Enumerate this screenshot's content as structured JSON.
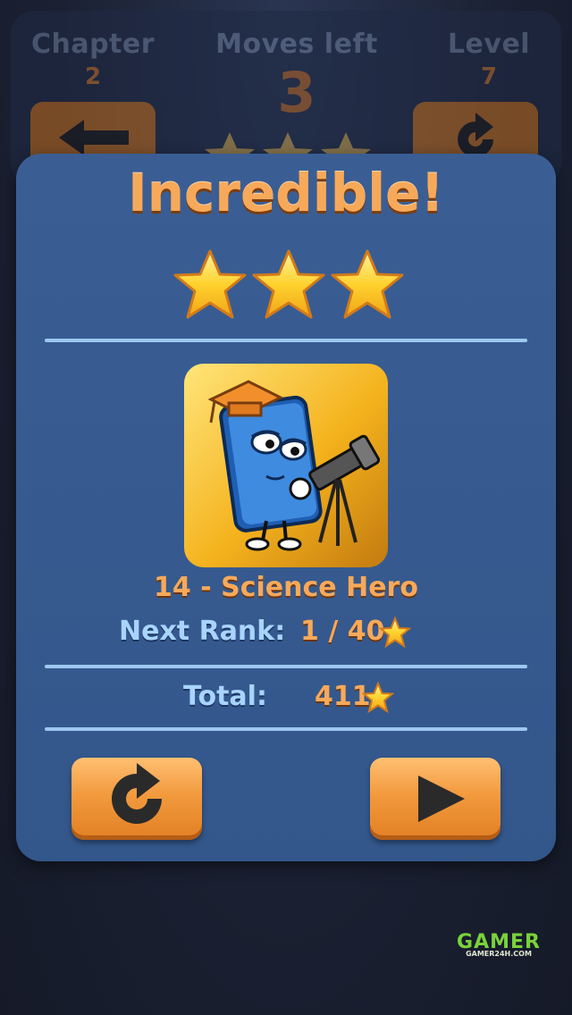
{
  "hud": {
    "chapter_label": "Chapter",
    "chapter_value": "2",
    "moves_label": "Moves left",
    "moves_value": "3",
    "level_label": "Level",
    "level_value": "7"
  },
  "modal": {
    "title": "Incredible!",
    "stars_earned": 3,
    "rank_name": "14 - Science Hero",
    "next_rank_label": "Next Rank:",
    "next_rank_value": "1 / 40",
    "total_label": "Total:",
    "total_value": "411",
    "replay_icon": "replay-icon",
    "play_icon": "play-icon"
  },
  "watermark": {
    "brand": "GAMER",
    "url": "GAMER24H.COM"
  },
  "colors": {
    "accent_orange": "#f29a3e",
    "panel_blue": "#3a5e94",
    "label_blue": "#a8d4ff"
  }
}
